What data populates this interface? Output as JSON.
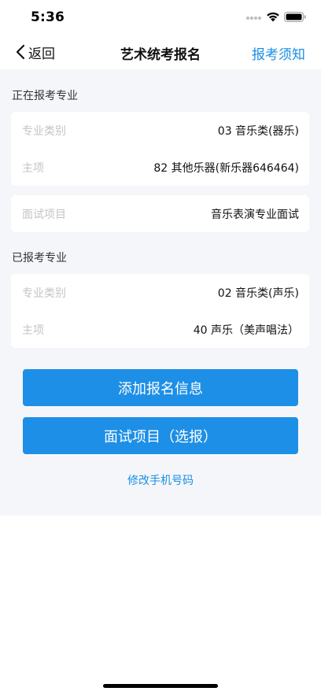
{
  "status_bar": {
    "time": "5:36"
  },
  "nav": {
    "back_label": "返回",
    "title": "艺术统考报名",
    "right_action": "报考须知"
  },
  "current": {
    "section_title": "正在报考专业",
    "category_label": "专业类别",
    "category_value": "03 音乐类(器乐)",
    "main_label": "主项",
    "main_value": "82 其他乐器(新乐器646464)",
    "interview_label": "面试项目",
    "interview_value": "音乐表演专业面试"
  },
  "registered": {
    "section_title": "已报考专业",
    "category_label": "专业类别",
    "category_value": "02 音乐类(声乐)",
    "main_label": "主项",
    "main_value": "40 声乐（美声唱法）"
  },
  "actions": {
    "add_label": "添加报名信息",
    "interview_select_label": "面试项目（选报）",
    "change_phone_label": "修改手机号码"
  },
  "colors": {
    "accent": "#1e8fe6",
    "link": "#1a8fe3",
    "background": "#f5f6fa"
  }
}
